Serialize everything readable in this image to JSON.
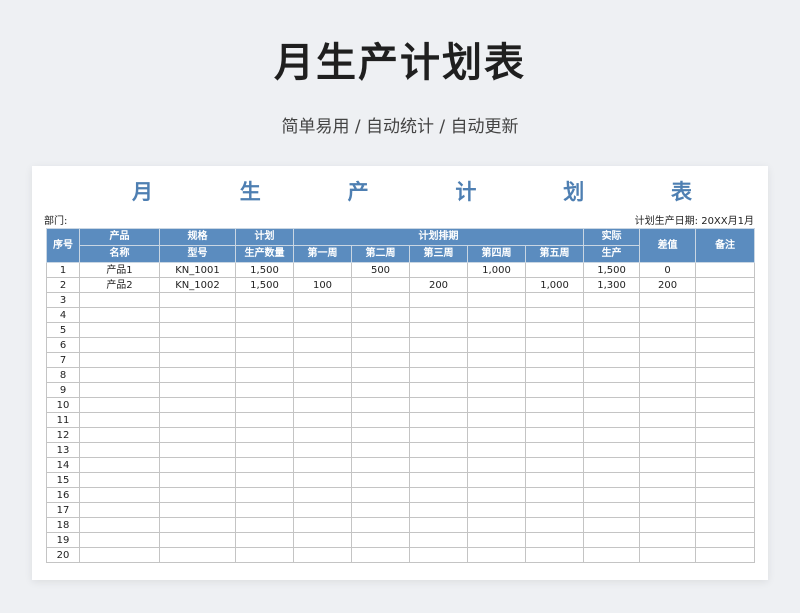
{
  "hero": {
    "title": "月生产计划表",
    "subtitle": "简单易用 / 自动统计 / 自动更新"
  },
  "sheet": {
    "title_chars": [
      "月",
      "生",
      "产",
      "计",
      "划",
      "表"
    ],
    "dept_label": "部门:",
    "plan_date_label": "计划生产日期: 20XX月1月",
    "headers": {
      "seq": "序号",
      "product_name": [
        "产品",
        "名称"
      ],
      "spec": [
        "规格",
        "型号"
      ],
      "plan_qty": [
        "计划",
        "生产数量"
      ],
      "schedule": "计划排期",
      "weeks": [
        "第一周",
        "第二周",
        "第三周",
        "第四周",
        "第五周"
      ],
      "actual": [
        "实际",
        "生产"
      ],
      "diff": "差值",
      "remark": "备注"
    },
    "rows": [
      [
        "1",
        "产品1",
        "KN_1001",
        "1,500",
        "",
        "500",
        "",
        "1,000",
        "",
        "1,500",
        "0",
        ""
      ],
      [
        "2",
        "产品2",
        "KN_1002",
        "1,500",
        "100",
        "",
        "200",
        "",
        "1,000",
        "1,300",
        "200",
        ""
      ],
      [
        "3",
        "",
        "",
        "",
        "",
        "",
        "",
        "",
        "",
        "",
        "",
        ""
      ],
      [
        "4",
        "",
        "",
        "",
        "",
        "",
        "",
        "",
        "",
        "",
        "",
        ""
      ],
      [
        "5",
        "",
        "",
        "",
        "",
        "",
        "",
        "",
        "",
        "",
        "",
        ""
      ],
      [
        "6",
        "",
        "",
        "",
        "",
        "",
        "",
        "",
        "",
        "",
        "",
        ""
      ],
      [
        "7",
        "",
        "",
        "",
        "",
        "",
        "",
        "",
        "",
        "",
        "",
        ""
      ],
      [
        "8",
        "",
        "",
        "",
        "",
        "",
        "",
        "",
        "",
        "",
        "",
        ""
      ],
      [
        "9",
        "",
        "",
        "",
        "",
        "",
        "",
        "",
        "",
        "",
        "",
        ""
      ],
      [
        "10",
        "",
        "",
        "",
        "",
        "",
        "",
        "",
        "",
        "",
        "",
        ""
      ],
      [
        "11",
        "",
        "",
        "",
        "",
        "",
        "",
        "",
        "",
        "",
        "",
        ""
      ],
      [
        "12",
        "",
        "",
        "",
        "",
        "",
        "",
        "",
        "",
        "",
        "",
        ""
      ],
      [
        "13",
        "",
        "",
        "",
        "",
        "",
        "",
        "",
        "",
        "",
        "",
        ""
      ],
      [
        "14",
        "",
        "",
        "",
        "",
        "",
        "",
        "",
        "",
        "",
        "",
        ""
      ],
      [
        "15",
        "",
        "",
        "",
        "",
        "",
        "",
        "",
        "",
        "",
        "",
        ""
      ],
      [
        "16",
        "",
        "",
        "",
        "",
        "",
        "",
        "",
        "",
        "",
        "",
        ""
      ],
      [
        "17",
        "",
        "",
        "",
        "",
        "",
        "",
        "",
        "",
        "",
        "",
        ""
      ],
      [
        "18",
        "",
        "",
        "",
        "",
        "",
        "",
        "",
        "",
        "",
        "",
        ""
      ],
      [
        "19",
        "",
        "",
        "",
        "",
        "",
        "",
        "",
        "",
        "",
        "",
        ""
      ],
      [
        "20",
        "",
        "",
        "",
        "",
        "",
        "",
        "",
        "",
        "",
        "",
        ""
      ]
    ]
  },
  "colors": {
    "header_bg": "#5b8cbf",
    "title_blue": "#4e7fb2",
    "page_bg": "#eef0f3"
  }
}
